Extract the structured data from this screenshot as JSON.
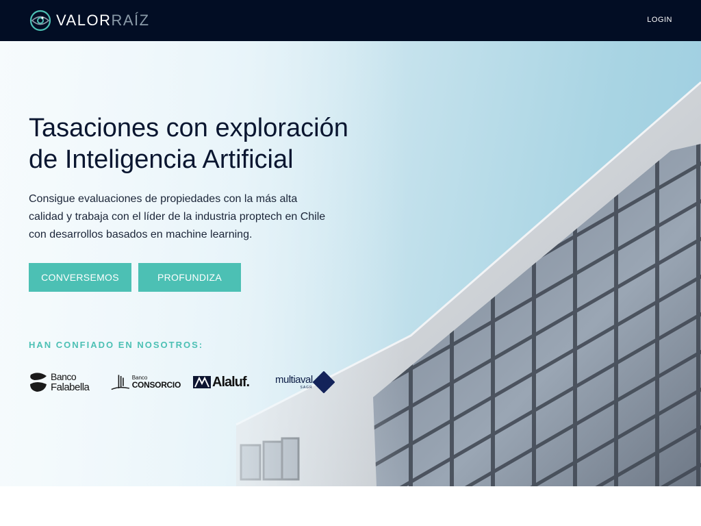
{
  "nav": {
    "brand_part1": "VALOR",
    "brand_part2": "RAÍZ",
    "login": "LOGIN"
  },
  "hero": {
    "title_line1": "Tasaciones con exploración",
    "title_line2": "de Inteligencia Artificial",
    "desc_line1": "Consigue evaluaciones de propiedades con la más alta",
    "desc_line2": "calidad y trabaja con el líder de la industria proptech en Chile",
    "desc_line3": "con desarrollos basados en machine learning.",
    "btn_primary": "CONVERSEMOS",
    "btn_secondary": "PROFUNDIZA"
  },
  "trust": {
    "heading": "HAN CONFIADO EN NOSOTROS:",
    "logos": [
      {
        "line1": "Banco",
        "line2": "Falabella",
        "icon": "falabella-logo-icon"
      },
      {
        "line1": "Banco",
        "line2": "CONSORCIO",
        "icon": "consorcio-logo-icon"
      },
      {
        "line1": "Alaluf.",
        "icon": "alaluf-logo-icon"
      },
      {
        "line1": "multiaval",
        "line2": "SAGR",
        "icon": "multiaval-logo-icon"
      }
    ]
  },
  "colors": {
    "nav_bg": "#020d24",
    "accent": "#4cc0b4",
    "title_text": "#0a1630"
  }
}
